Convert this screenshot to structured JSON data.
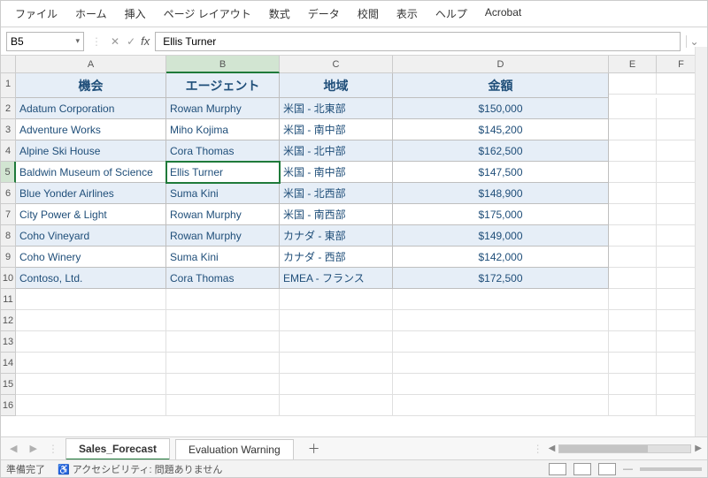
{
  "menu": [
    "ファイル",
    "ホーム",
    "挿入",
    "ページ レイアウト",
    "数式",
    "データ",
    "校閲",
    "表示",
    "ヘルプ",
    "Acrobat"
  ],
  "namebox": "B5",
  "formula_value": "Ellis Turner",
  "columns": [
    "A",
    "B",
    "C",
    "D",
    "E",
    "F"
  ],
  "selected_col_index": 1,
  "selected_row_index": 4,
  "header_row": {
    "A": "機会",
    "B": "エージェント",
    "C": "地域",
    "D": "金額"
  },
  "rows": [
    {
      "A": "Adatum Corporation",
      "B": "Rowan Murphy",
      "C": "米国 - 北東部",
      "D": "$150,000"
    },
    {
      "A": "Adventure Works",
      "B": "Miho Kojima",
      "C": "米国 - 南中部",
      "D": "$145,200"
    },
    {
      "A": "Alpine Ski House",
      "B": "Cora Thomas",
      "C": "米国 - 北中部",
      "D": "$162,500"
    },
    {
      "A": "Baldwin Museum of Science",
      "B": "Ellis Turner",
      "C": "米国 - 南中部",
      "D": "$147,500"
    },
    {
      "A": "Blue Yonder Airlines",
      "B": "Suma Kini",
      "C": "米国 - 北西部",
      "D": "$148,900"
    },
    {
      "A": "City Power & Light",
      "B": "Rowan Murphy",
      "C": "米国 - 南西部",
      "D": "$175,000"
    },
    {
      "A": "Coho Vineyard",
      "B": "Rowan Murphy",
      "C": "カナダ - 東部",
      "D": "$149,000"
    },
    {
      "A": "Coho Winery",
      "B": "Suma Kini",
      "C": "カナダ - 西部",
      "D": "$142,000"
    },
    {
      "A": "Contoso, Ltd.",
      "B": "Cora Thomas",
      "C": "EMEA - フランス",
      "D": "$172,500"
    }
  ],
  "empty_rows": [
    11,
    12,
    13,
    14,
    15,
    16
  ],
  "tabs": {
    "active": "Sales_Forecast",
    "other": "Evaluation Warning"
  },
  "status": {
    "ready": "準備完了",
    "accessibility_label": "アクセシビリティ: 問題ありません"
  }
}
